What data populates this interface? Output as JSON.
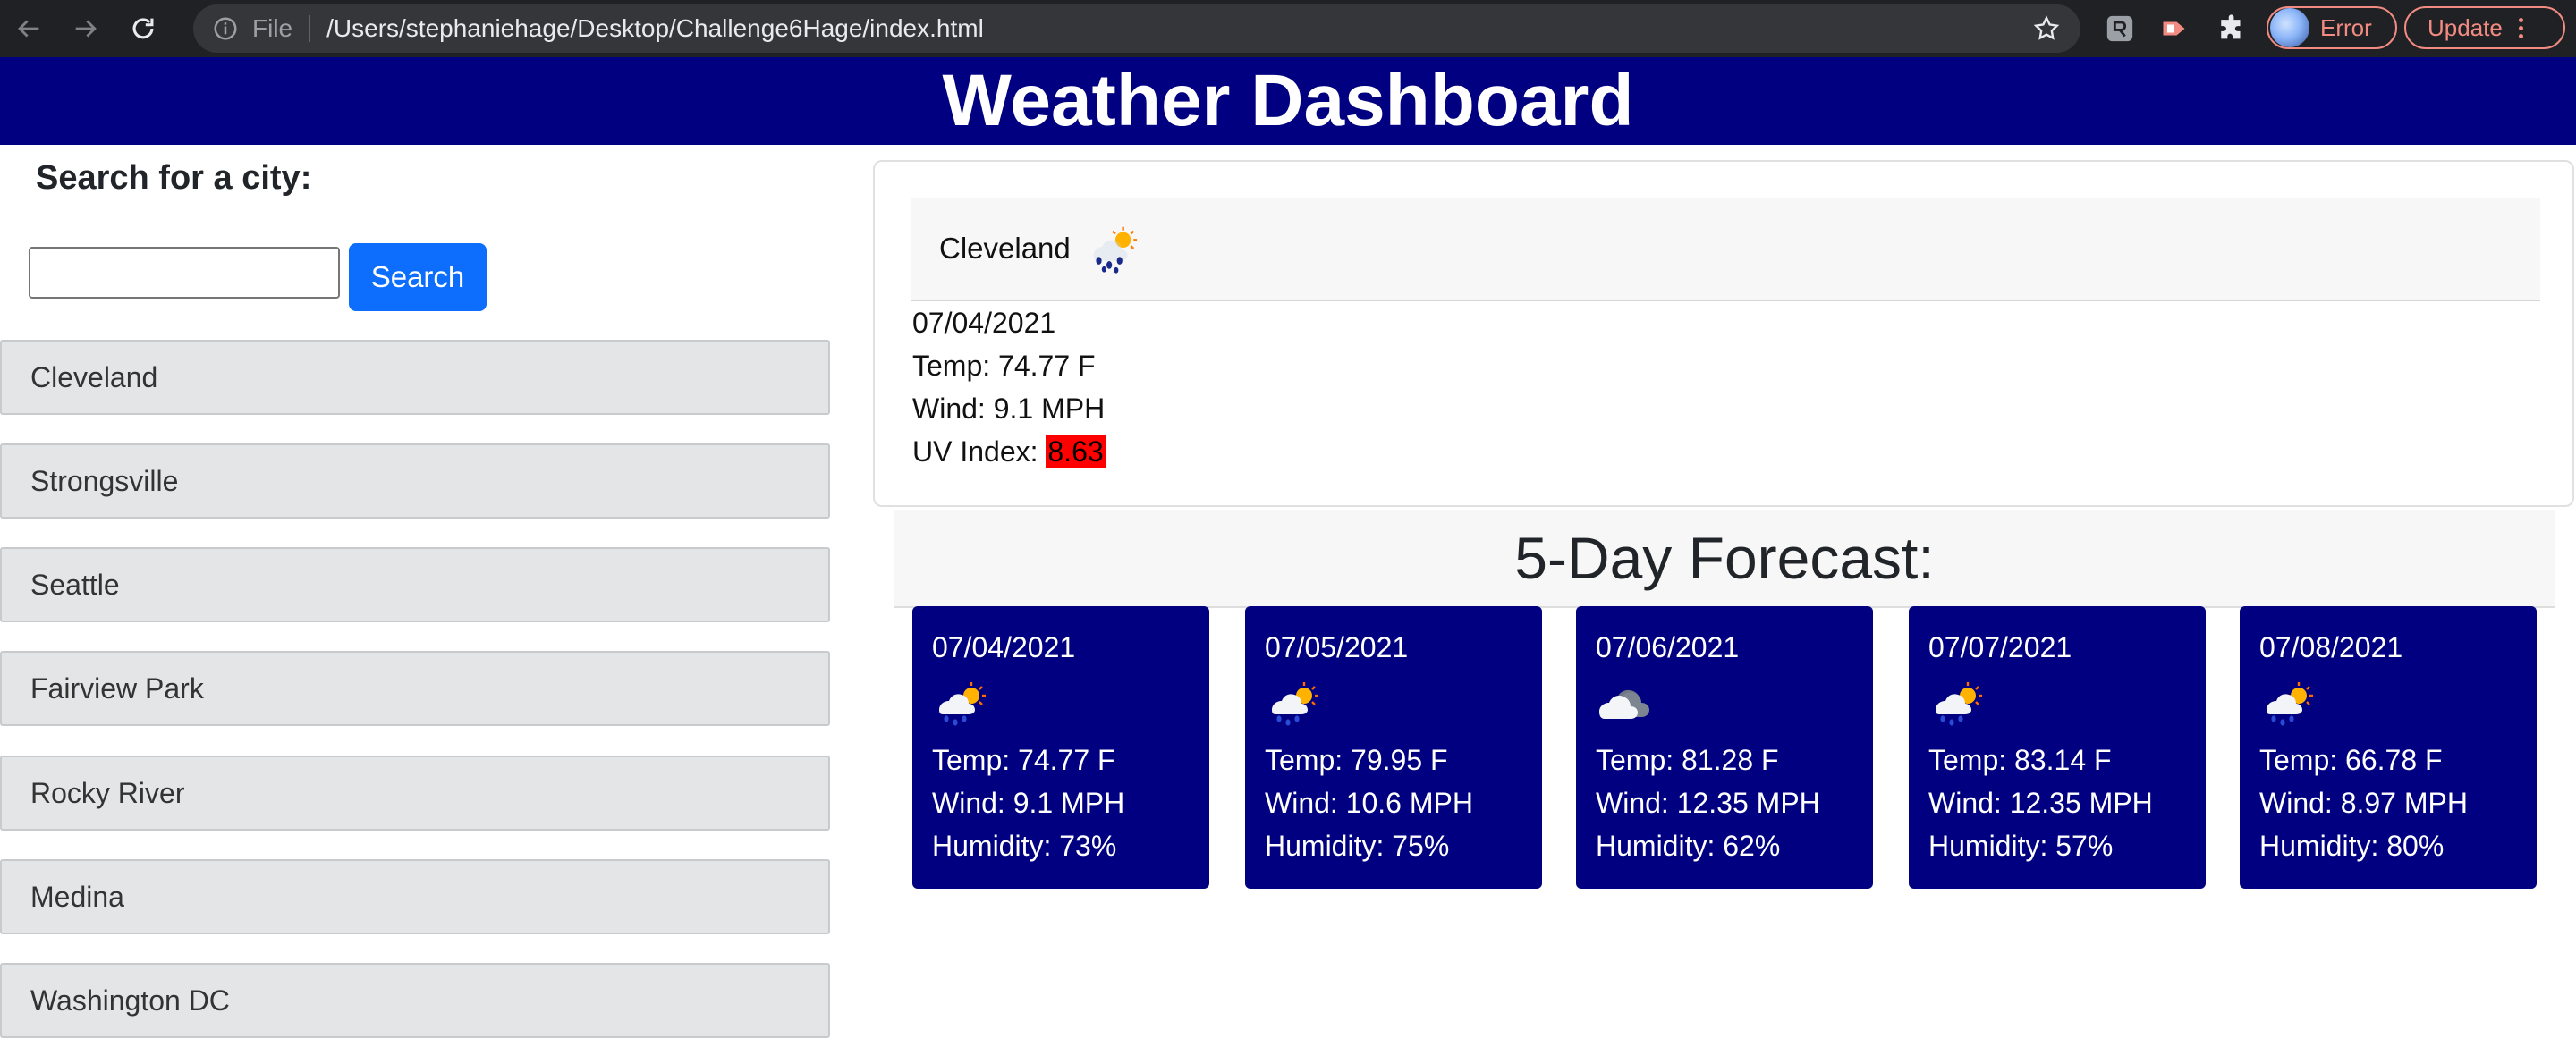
{
  "browser": {
    "scheme": "File",
    "url": "/Users/stephaniehage/Desktop/Challenge6Hage/index.html",
    "profile_status": "Error",
    "update_label": "Update"
  },
  "header": {
    "title": "Weather Dashboard"
  },
  "search": {
    "label": "Search for a city:",
    "input_value": "",
    "button_label": "Search"
  },
  "history": [
    "Cleveland",
    "Strongsville",
    "Seattle",
    "Fairview Park",
    "Rocky River",
    "Medina",
    "Washington DC"
  ],
  "current": {
    "city": "Cleveland",
    "icon": "rain-sun-icon",
    "date": "07/04/2021",
    "temp": "Temp: 74.77 F",
    "wind": "Wind: 9.1 MPH",
    "uv_label": "UV Index: ",
    "uv_value": "8.63",
    "uv_color": "#ff0000"
  },
  "forecast": {
    "title": "5-Day Forecast:",
    "days": [
      {
        "date": "07/04/2021",
        "icon": "rain-sun-icon",
        "temp": "Temp: 74.77 F",
        "wind": "Wind: 9.1 MPH",
        "humidity": "Humidity: 73%"
      },
      {
        "date": "07/05/2021",
        "icon": "rain-sun-icon",
        "temp": "Temp: 79.95 F",
        "wind": "Wind: 10.6 MPH",
        "humidity": "Humidity: 75%"
      },
      {
        "date": "07/06/2021",
        "icon": "cloud-icon",
        "temp": "Temp: 81.28 F",
        "wind": "Wind: 12.35 MPH",
        "humidity": "Humidity: 62%"
      },
      {
        "date": "07/07/2021",
        "icon": "rain-sun-icon",
        "temp": "Temp: 83.14 F",
        "wind": "Wind: 12.35 MPH",
        "humidity": "Humidity: 57%"
      },
      {
        "date": "07/08/2021",
        "icon": "rain-sun-icon",
        "temp": "Temp: 66.78 F",
        "wind": "Wind: 8.97 MPH",
        "humidity": "Humidity: 80%"
      }
    ]
  },
  "colors": {
    "header_bg": "#000080",
    "card_bg": "#000080",
    "search_button": "#0d6efd",
    "uv_high": "#ff0000"
  }
}
